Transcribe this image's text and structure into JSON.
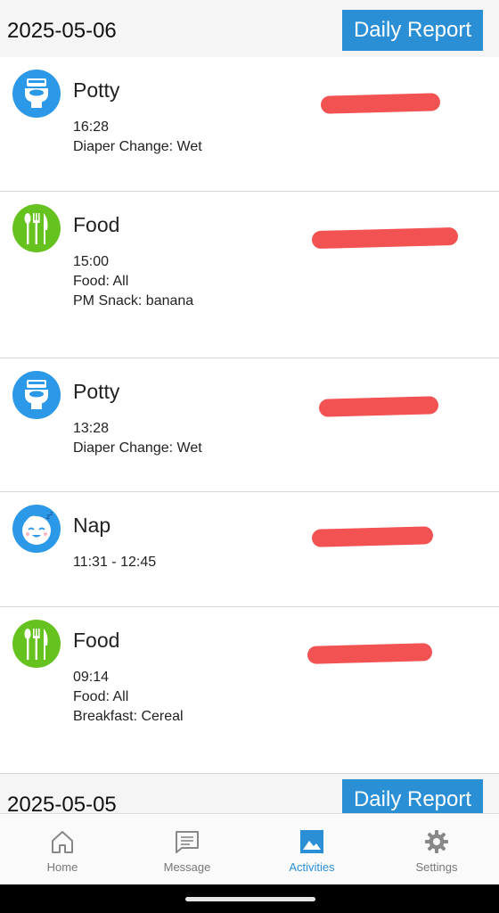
{
  "days": [
    {
      "date": "2025-05-06",
      "report_label": "Daily Report",
      "entries": [
        {
          "title": "Potty",
          "icon": "toilet-icon",
          "color": "#2b98e8",
          "lines": [
            "16:28",
            "Diaper Change: Wet"
          ]
        },
        {
          "title": "Food",
          "icon": "utensils-icon",
          "color": "#66c21e",
          "lines": [
            "15:00",
            "Food: All",
            "PM Snack: banana"
          ]
        },
        {
          "title": "Potty",
          "icon": "toilet-icon",
          "color": "#2b98e8",
          "lines": [
            "13:28",
            "Diaper Change: Wet"
          ]
        },
        {
          "title": "Nap",
          "icon": "sleeping-baby-icon",
          "color": "#2b98e8",
          "lines": [
            "11:31 - 12:45"
          ]
        },
        {
          "title": "Food",
          "icon": "utensils-icon",
          "color": "#66c21e",
          "lines": [
            "09:14",
            "Food: All",
            "Breakfast: Cereal"
          ]
        }
      ]
    },
    {
      "date": "2025-05-05",
      "report_label": "Daily Report"
    }
  ],
  "tabs": [
    {
      "label": "Home",
      "icon": "home-icon"
    },
    {
      "label": "Message",
      "icon": "message-icon"
    },
    {
      "label": "Activities",
      "icon": "picture-icon",
      "active": true
    },
    {
      "label": "Settings",
      "icon": "gear-icon"
    }
  ],
  "colors": {
    "accent": "#2b8fd6",
    "redaction": "#f25252"
  }
}
